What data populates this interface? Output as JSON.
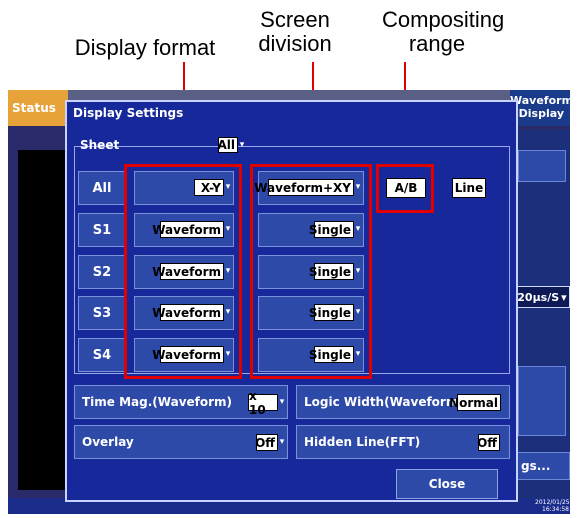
{
  "annotations": {
    "display_format": "Display format",
    "screen_division_line1": "Screen",
    "screen_division_line2": "division",
    "compositing_range_line1": "Compositing",
    "compositing_range_line2": "range"
  },
  "background_ui": {
    "status_tab": "Status",
    "right_tab_line1": "Waveform",
    "right_tab_line2": "Display",
    "timebase_value": "20μs/S",
    "settings_button": "gs...",
    "date": "2012/01/25",
    "time": "16:34:58"
  },
  "dialog": {
    "title": "Display Settings",
    "sheet_label": "Sheet",
    "sheet_value": "All",
    "rows": [
      {
        "label": "All",
        "format": "X-Y",
        "division": "Waveform+XY"
      },
      {
        "label": "S1",
        "format": "Waveform",
        "division": "Single"
      },
      {
        "label": "S2",
        "format": "Waveform",
        "division": "Single"
      },
      {
        "label": "S3",
        "format": "Waveform",
        "division": "Single"
      },
      {
        "label": "S4",
        "format": "Waveform",
        "division": "Single"
      }
    ],
    "ab_button": "A/B",
    "line_button": "Line",
    "time_mag_label": "Time Mag.(Waveform)",
    "time_mag_value": "x 10",
    "logic_width_label": "Logic Width(Waveform)",
    "logic_width_value": "Normal",
    "overlay_label": "Overlay",
    "overlay_value": "Off",
    "hidden_line_label": "Hidden Line(FFT)",
    "hidden_line_value": "Off",
    "close_button": "Close"
  },
  "colors": {
    "dialog_bg": "#17299a",
    "highlight": "#e00000",
    "status_tab": "#e8a23a"
  }
}
